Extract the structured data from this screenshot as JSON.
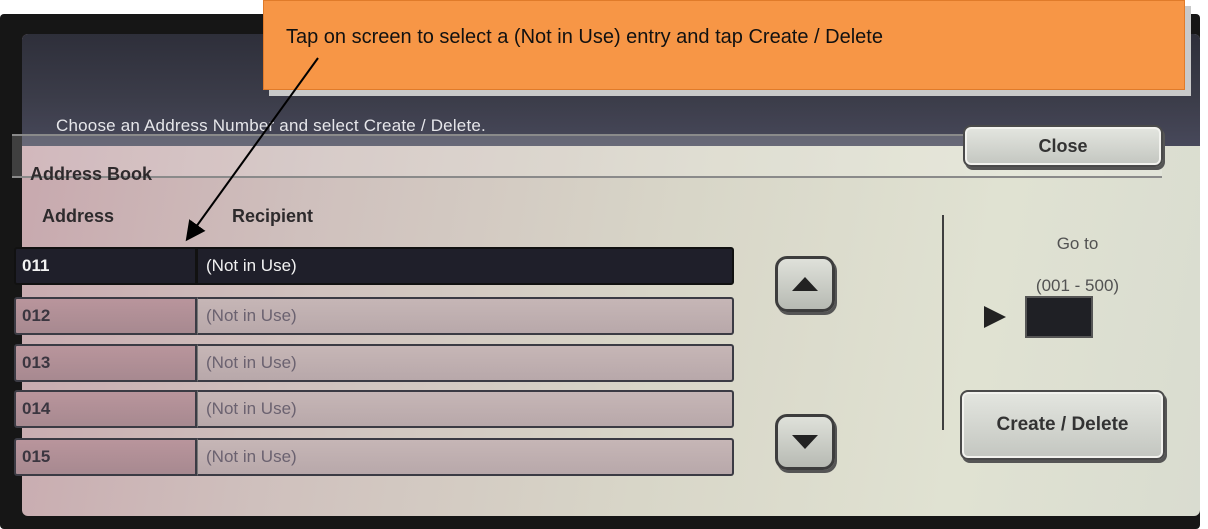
{
  "message": "Choose an Address Number and select Create / Delete.",
  "panel": {
    "title": "Address Book",
    "close_label": "Close",
    "columns": {
      "address": "Address",
      "recipient": "Recipient"
    },
    "rows": [
      {
        "address": "011",
        "recipient": "(Not in Use)",
        "selected": true
      },
      {
        "address": "012",
        "recipient": "(Not in Use)",
        "selected": false
      },
      {
        "address": "013",
        "recipient": "(Not in Use)",
        "selected": false
      },
      {
        "address": "014",
        "recipient": "(Not in Use)",
        "selected": false
      },
      {
        "address": "015",
        "recipient": "(Not in Use)",
        "selected": false
      }
    ],
    "scroll_up_icon": "triangle-up-icon",
    "scroll_down_icon": "triangle-down-icon"
  },
  "goto": {
    "label": "Go to",
    "range": "(001 - 500)",
    "value": ""
  },
  "create_delete_label": "Create / Delete",
  "callout": {
    "text": "Tap on screen to select a (Not in Use) entry and tap Create / Delete",
    "color": "#f79646"
  }
}
